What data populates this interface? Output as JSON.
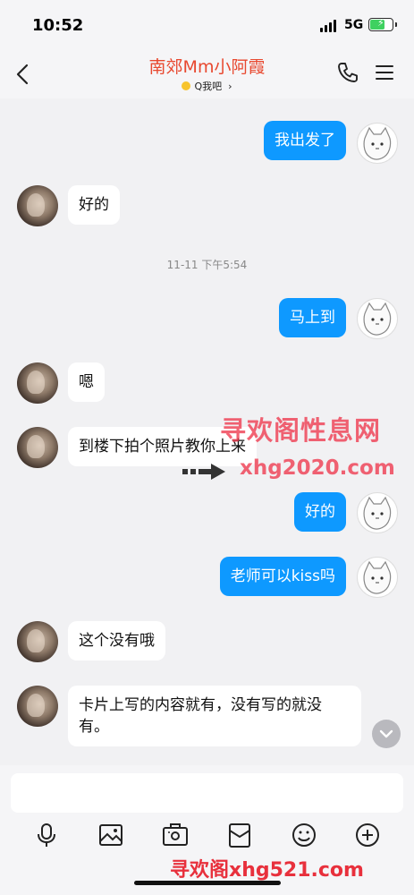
{
  "status_bar": {
    "time": "10:52",
    "network": "5G"
  },
  "header": {
    "title": "南郊Mm小阿霞",
    "subtitle": "Q我吧"
  },
  "messages": [
    {
      "side": "out",
      "text": "我出发了"
    },
    {
      "side": "in",
      "text": "好的"
    },
    {
      "side": "time",
      "text": "11-11 下午5:54"
    },
    {
      "side": "out",
      "text": "马上到"
    },
    {
      "side": "in",
      "text": "嗯"
    },
    {
      "side": "in",
      "text": "到楼下拍个照片教你上来"
    },
    {
      "side": "out",
      "text": "好的"
    },
    {
      "side": "out",
      "text": "老师可以kiss吗"
    },
    {
      "side": "in",
      "text": "这个没有哦"
    },
    {
      "side": "in",
      "text": "卡片上写的内容就有，没有写的就没有。"
    }
  ],
  "watermarks": {
    "mid_title": "寻欢阁性息网",
    "mid_url": "xhg2020.com",
    "bottom": "寻欢阁xhg521.com"
  },
  "toolbar": [
    "microphone-icon",
    "image-icon",
    "camera-icon",
    "red-packet-icon",
    "emoji-icon",
    "plus-icon"
  ],
  "colors": {
    "bubble_out": "#0e99ff",
    "title": "#e8482f",
    "watermark": "#ee374b"
  }
}
